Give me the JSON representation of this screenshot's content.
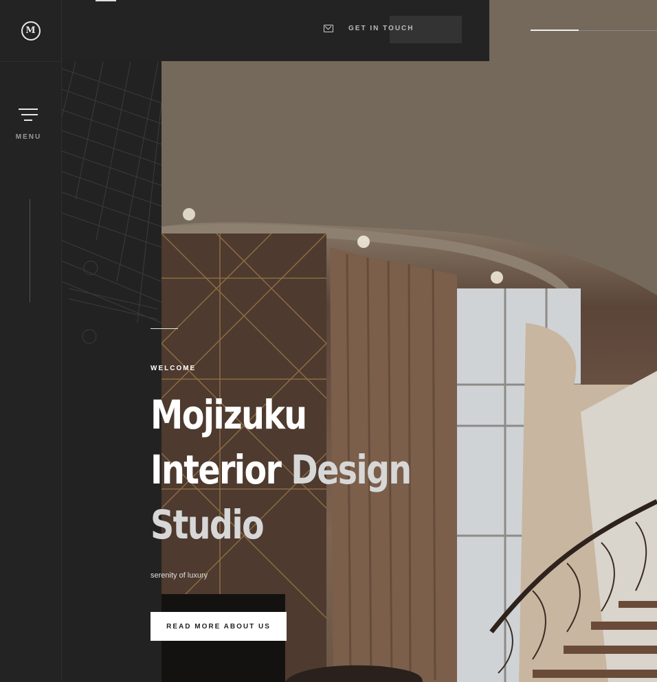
{
  "header": {
    "contact_label": "GET IN TOUCH",
    "contact_icon": "mail-icon"
  },
  "sidebar": {
    "logo_icon": "monogram-m-logo",
    "menu_label": "MENU",
    "menu_icon": "hamburger-icon"
  },
  "hero": {
    "eyebrow": "WELCOME",
    "title_line1": "Mojizuku",
    "title_line2_a": "Interior",
    "title_line2_b": "Design",
    "title_line3": "Studio",
    "tagline": "serenity of luxury",
    "button_label": "READ MORE ABOUT US",
    "slider_progress": 0.38
  },
  "colors": {
    "panel": "#232323",
    "accent": "#ffffff",
    "muted_text": "#9a9a9a"
  }
}
